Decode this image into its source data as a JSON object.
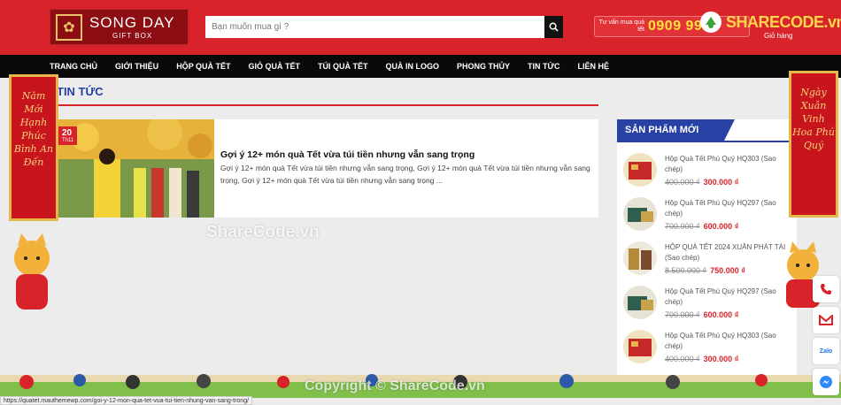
{
  "brand": {
    "name": "SONG DAY",
    "tagline": "GIFT BOX",
    "primary_color": "#d8232a",
    "nav_color": "#0a0a0a",
    "accent_blue": "#2741a5"
  },
  "header": {
    "search_placeholder": "Bạn muốn mua gì ?",
    "hotline_label": "Tư vấn mua quà tết",
    "hotline_number": "0909 99...",
    "cart_label": "Giỏ hàng",
    "overlay_logo": "SHARECODE",
    "overlay_logo_suffix": ".vn"
  },
  "nav": {
    "items": [
      "TRANG CHỦ",
      "GIỚI THIỆU",
      "HỘP QUÀ TẾT",
      "GIỎ QUÀ TẾT",
      "TÚI QUÀ TẾT",
      "QUÀ IN LOGO",
      "PHONG THỦY",
      "TIN TỨC",
      "LIÊN HỆ"
    ]
  },
  "main": {
    "section_title": "TIN TỨC",
    "post": {
      "date_day": "20",
      "date_month": "Th11",
      "title": "Gợi ý 12+ món quà Tết vừa túi tiền nhưng vẫn sang trọng",
      "excerpt": "Gợi ý 12+ món quà Tết vừa túi tiền nhưng vẫn sang trọng, Gợi ý 12+ món quà Tết vừa túi tiền nhưng vẫn sang trọng, Gợi ý 12+ món quà Tết vừa túi tiền nhưng vẫn sang trọng ..."
    }
  },
  "sidebar": {
    "title": "SẢN PHẨM MỚI",
    "products": [
      {
        "name": "Hộp Quà Tết Phú Quý HQ303 (Sao chép)",
        "old_price": "400.000 ₫",
        "new_price": "300.000 ₫",
        "thumb_color": "#c62828"
      },
      {
        "name": "Hộp Quà Tết Phú Quý HQ297 (Sao chép)",
        "old_price": "700.000 ₫",
        "new_price": "600.000 ₫",
        "thumb_color": "#2e5e4e"
      },
      {
        "name": "HỘP QUÀ TẾT 2024 XUÂN PHÁT TÀI (Sao chép)",
        "old_price": "8.500.000 ₫",
        "new_price": "750.000 ₫",
        "thumb_color": "#b58a3a"
      },
      {
        "name": "Hộp Quà Tết Phú Quý HQ297 (Sao chép)",
        "old_price": "700.000 ₫",
        "new_price": "600.000 ₫",
        "thumb_color": "#2e5e4e"
      },
      {
        "name": "Hộp Quà Tết Phú Quý HQ303 (Sao chép)",
        "old_price": "400.000 ₫",
        "new_price": "300.000 ₫",
        "thumb_color": "#c62828"
      }
    ]
  },
  "decorations": {
    "left_banner": "Năm Mới Hạnh Phúc Bình An Đến",
    "right_banner": "Ngày Xuân Vinh Hoa Phú Quý"
  },
  "overlays": {
    "watermark": "ShareCode.vn",
    "copyright": "Copyright © ShareCode.vn"
  },
  "status_bar": {
    "url": "https://quatet.mauthemewp.com/goi-y-12-mon-qua-tet-vua-tui-tien-nhung-van-sang-trong/"
  },
  "contact": {
    "items": [
      "phone-icon",
      "gmail-icon",
      "zalo-icon",
      "messenger-icon"
    ],
    "zalo_label": "Zalo"
  }
}
